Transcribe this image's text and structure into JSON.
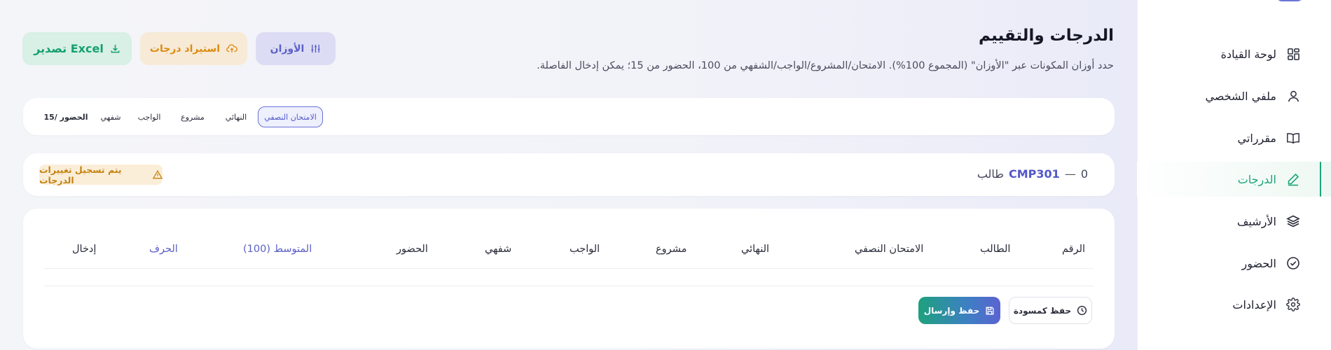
{
  "sidebar": {
    "items": [
      {
        "label": "لوحة القيادة",
        "icon": "dashboard-grid-icon"
      },
      {
        "label": "ملفي الشخصي",
        "icon": "user-icon"
      },
      {
        "label": "مقرراتي",
        "icon": "book-icon"
      },
      {
        "label": "الدرجات",
        "icon": "pencil-icon",
        "active": true
      },
      {
        "label": "الأرشيف",
        "icon": "layers-icon"
      },
      {
        "label": "الحضور",
        "icon": "check-circle-icon"
      },
      {
        "label": "الإعدادات",
        "icon": "gear-icon"
      }
    ]
  },
  "header": {
    "title": "الدرجات والتقييم",
    "description": "حدد أوزان المكونات عبر \"الأوزان\" (المجموع 100%). الامتحان/المشروع/الواجب/الشفهي من 100، الحضور من 15؛ يمكن إدخال الفاصلة.",
    "weights_label": "الأوزان",
    "import_label": "استيراد درجات",
    "export_label": "تصدير Excel"
  },
  "tabs": [
    {
      "label": "الامتحان النصفي",
      "active": true
    },
    {
      "label": "النهائي"
    },
    {
      "label": "مشروع"
    },
    {
      "label": "الواجب"
    },
    {
      "label": "شفهي"
    },
    {
      "label": "الحضور /15"
    }
  ],
  "course": {
    "count": "0",
    "dash": "—",
    "code": "CMP301",
    "student_word": "طالب",
    "status": "يتم تسجيل تغييرات الدرجات"
  },
  "table": {
    "headers": [
      "الرقم",
      "الطالب",
      "الامتحان النصفي",
      "النهائي",
      "مشروع",
      "الواجب",
      "شفهي",
      "الحضور",
      "المتوسط (100)",
      "الحرف",
      "إدخال"
    ]
  },
  "actions": {
    "draft_label": "حفظ كمسودة",
    "save_label": "حفظ وإرسال"
  },
  "colors": {
    "accent": "#5b5fc7",
    "success": "#1aa57a",
    "warning": "#dc8b10"
  }
}
